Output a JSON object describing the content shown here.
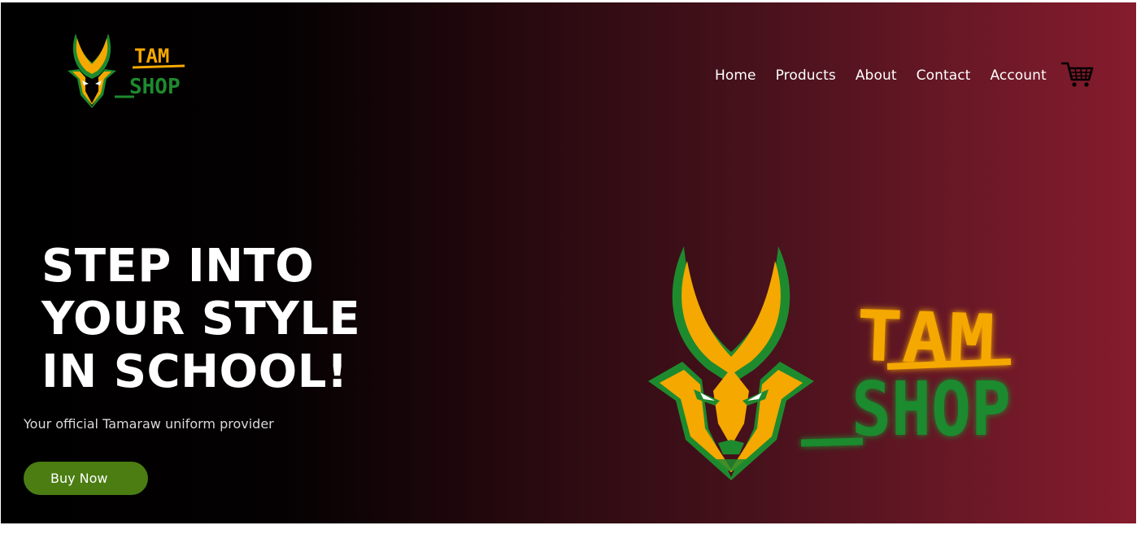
{
  "brand": {
    "logo_name": "TAM SHOP",
    "logo_line1": "TAM",
    "logo_line2": "SHOP",
    "colors": {
      "gold": "#f5a800",
      "green": "#1e8a2e",
      "button_green": "#4b7d12",
      "background_dark": "#000000",
      "background_maroon": "#851c2d"
    }
  },
  "nav": {
    "items": [
      {
        "label": "Home"
      },
      {
        "label": "Products"
      },
      {
        "label": "About"
      },
      {
        "label": "Contact"
      },
      {
        "label": "Account"
      }
    ],
    "cart_icon": "shopping-cart-icon"
  },
  "hero": {
    "headline_lines": [
      "STEP INTO",
      "YOUR STYLE",
      "IN SCHOOL!"
    ],
    "subtitle": "Your official Tamaraw uniform provider",
    "cta_label": "Buy Now"
  }
}
